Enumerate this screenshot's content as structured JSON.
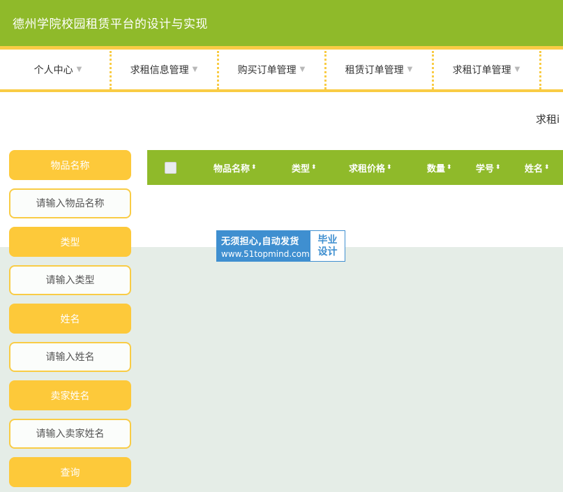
{
  "app": {
    "title": "德州学院校园租赁平台的设计与实现"
  },
  "nav": {
    "items": [
      {
        "label": "个人中心",
        "caret": "▼"
      },
      {
        "label": "求租信息管理",
        "caret": "▼"
      },
      {
        "label": "购买订单管理",
        "caret": "▼"
      },
      {
        "label": "租赁订单管理",
        "caret": "▼"
      },
      {
        "label": "求租订单管理",
        "caret": "▼"
      }
    ]
  },
  "page": {
    "subtitle": "求租i"
  },
  "search": {
    "fields": [
      {
        "label": "物品名称",
        "placeholder": "请输入物品名称"
      },
      {
        "label": "类型",
        "placeholder": "请输入类型"
      },
      {
        "label": "姓名",
        "placeholder": "请输入姓名"
      },
      {
        "label": "卖家姓名",
        "placeholder": "请输入卖家姓名"
      }
    ],
    "button_label": "查询"
  },
  "table": {
    "sort_glyph": "⬍",
    "columns": [
      "物品名称",
      "类型",
      "求租价格",
      "数量",
      "学号",
      "姓名"
    ]
  },
  "watermark": {
    "line1": "无须担心,自动发货",
    "line2": "www.51topmind.com",
    "badge_line1": "毕业",
    "badge_line2": "设计"
  },
  "colors": {
    "header": "#8fba2a",
    "accent_yellow": "#fdc93a",
    "lower_background": "#e5ede7",
    "watermark_blue": "#3f8fd0"
  }
}
